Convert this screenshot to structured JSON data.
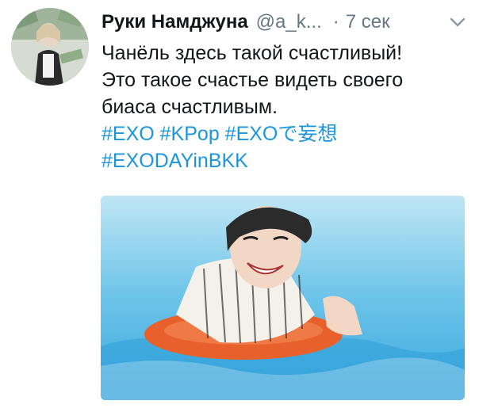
{
  "tweet": {
    "author_name": "Руки Намджуна",
    "author_handle": "@a_k...",
    "separator": "·",
    "timestamp": "7 сек",
    "text_lines": [
      "Чанёль здесь такой счастливый!",
      "Это такое счастье видеть своего",
      "биаса счастливым."
    ],
    "hashtags_line1": [
      "#EXO",
      "#KPop",
      "#EXOで妄想"
    ],
    "hashtags_line2": [
      "#EXODAYinBKK"
    ]
  },
  "icons": {
    "more": "chevron-down-icon",
    "avatar": "avatar",
    "media": "photo"
  },
  "colors": {
    "name": "#14171a",
    "secondary": "#657786",
    "link": "#1b95e0",
    "background": "#ffffff"
  }
}
